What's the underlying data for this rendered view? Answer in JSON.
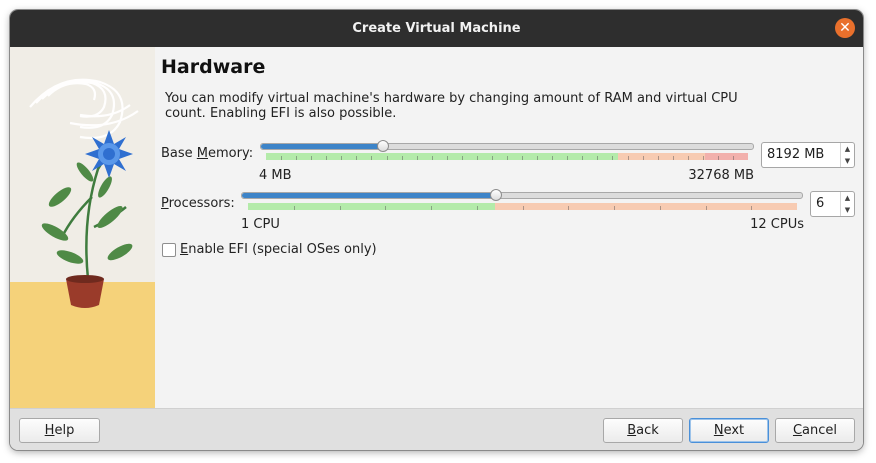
{
  "window": {
    "title": "Create Virtual Machine",
    "close_glyph": "✕"
  },
  "page": {
    "heading": "Hardware",
    "description": "You can modify virtual machine's hardware by changing amount of RAM and virtual CPU count. Enabling EFI is also possible."
  },
  "memory": {
    "label_prefix": "Base ",
    "label_mnemonic": "M",
    "label_suffix": "emory:",
    "value": "8192 MB",
    "min_label": "4 MB",
    "max_label": "32768 MB",
    "min": 4,
    "max": 32768,
    "current": 8192,
    "range_green_fraction": 0.73,
    "range_orange_fraction": 0.18,
    "range_red_fraction": 0.09
  },
  "processors": {
    "label_mnemonic": "P",
    "label_suffix": "rocessors:",
    "value": "6",
    "min_label": "1 CPU",
    "max_label": "12 CPUs",
    "min": 1,
    "max": 12,
    "current": 6,
    "range_green_fraction": 0.45,
    "range_orange_fraction": 0.55
  },
  "efi": {
    "label_mnemonic": "E",
    "label_suffix": "nable EFI (special OSes only)",
    "checked": false
  },
  "buttons": {
    "help_mnemonic": "H",
    "help_suffix": "elp",
    "back_mnemonic": "B",
    "back_suffix": "ack",
    "next_mnemonic": "N",
    "next_suffix": "ext",
    "cancel_mnemonic": "C",
    "cancel_suffix": "ancel"
  },
  "icons": {
    "close": "close-icon",
    "spin_up": "chevron-up-icon",
    "spin_down": "chevron-down-icon",
    "illustration": "plant-illustration"
  },
  "colors": {
    "accent": "#3d84c8",
    "close": "#e9702c",
    "titlebar": "#2e2e2e"
  }
}
